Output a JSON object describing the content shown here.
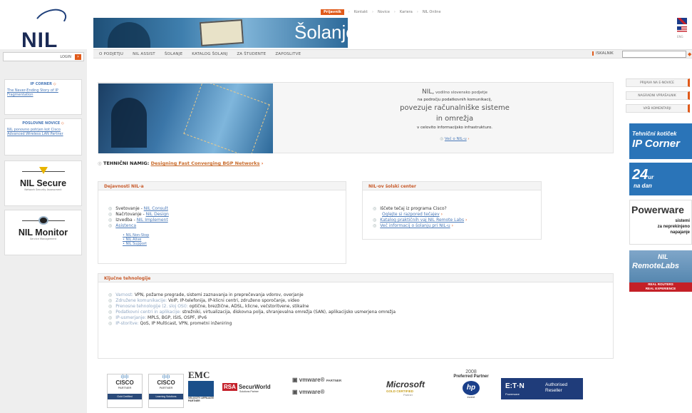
{
  "brand": {
    "logo_text": "NIL"
  },
  "topnav": {
    "active": "Prijavnik",
    "items": [
      "Kontakt",
      "Novice",
      "Kariera",
      "NIL Online"
    ]
  },
  "banner": {
    "title": "Šolanje"
  },
  "flags": {
    "label": "ENG"
  },
  "menu": {
    "items": [
      "O PODJETJU",
      "NIL ASSIST",
      "ŠOLANJE",
      "KATALOG ŠOLANJ",
      "ZA ŠTUDENTE",
      "ZAPOSLITVE"
    ],
    "search_label": "ISKALNIK",
    "search_placeholder": ""
  },
  "left": {
    "login": "LOGIN",
    "ip_corner": {
      "title": "IP CORNER",
      "text": "The Never-Ending Story of IP Fragmentation"
    },
    "news": {
      "title": "POSLOVNE NOVICE",
      "text": "NIL ponovno potrjen kot Cisco Advanced Wireless LAN Partner"
    },
    "secure": {
      "name": "NIL Secure",
      "sub": "Network Security Assessment"
    },
    "monitor": {
      "name": "NIL Monitor",
      "sub": "Service Management"
    }
  },
  "right": {
    "buttons": [
      "PRIJAVA NA E-NOVICE",
      "NAGRADNI VPRAŠALNIK",
      "VAŠI KOMENTARJI"
    ],
    "ipcorner": {
      "a": "Tehnični kotiček",
      "b": "IP Corner"
    },
    "h24": {
      "a": "24",
      "b": "ur",
      "c": "na dan"
    },
    "power": {
      "a": "Powerware",
      "b": "sistemi",
      "c": "za neprekinjeno",
      "d": "napajanje"
    },
    "remote": {
      "a": "NIL",
      "b": "RemoteLabs",
      "c": "REAL ROUTERS",
      "d": "REAL EXPERIENCE"
    }
  },
  "hero": {
    "l1": "NIL,",
    "l1b": " vodilno slovensko podjetje",
    "l2": "na področju podatkovnih komunikacij,",
    "l3": "povezuje računalniške sisteme",
    "l3b": "in omrežja",
    "l4": "v celovito informacijsko infrastrukturo.",
    "l5": "Več o NIL-u"
  },
  "tech": {
    "label": "TEHNIČNI NAMIG:",
    "link": "Designing Fast Converging BGP Networks"
  },
  "activities": {
    "title": "Dejavnosti NIL-a",
    "rows": [
      {
        "label": "Svetovanje - ",
        "link": "NIL Consult"
      },
      {
        "label": "Načrtovanje - ",
        "link": "NIL Design"
      },
      {
        "label": "Izvedba - ",
        "link": "NIL Implement"
      },
      {
        "label": "",
        "link": "Asistenca"
      }
    ],
    "sub": [
      "NIL Non-Stop",
      "NIL Alive",
      "NIL Support"
    ]
  },
  "school": {
    "title": "NIL-ov šolski center",
    "rows": [
      {
        "label": "Iščete tečaj iz programa Cisco?",
        "link": "Oglejte si razpored tečajev"
      },
      {
        "label": "",
        "link": "Katalog praktičnih vaj NIL Remote Labs"
      },
      {
        "label": "",
        "link": "Več informacij o šolanju pri NIL-u"
      }
    ]
  },
  "key": {
    "title": "Ključne tehnologije",
    "rows": [
      {
        "k": "Varnost:",
        "v": " VPN, požarne pregrade, sistemi zaznavanja in preprečevanja vdorov, overjanje"
      },
      {
        "k": "Združene komunikacije:",
        "v": " VoIP, IP-telefonija, IP-klicni centri, združeno sporočanje, video"
      },
      {
        "k": "Prenosne tehnologije (2. sloj OSI):",
        "v": " optične, brezžične, ADSL, klicne, večstoritvene, stikalne"
      },
      {
        "k": "Podatkovni centri in aplikacije:",
        "v": " strežniki, virtualizacija, diskovna polja, shranjevalna omrežja (SAN), aplikacijsko usmerjena omrežja"
      },
      {
        "k": "IP-usmerjanje:",
        "v": " MPLS, BGP, ISIS, OSPF, IPv6"
      },
      {
        "k": "IP-storitve:",
        "v": " QoS, IP Multicast, VPN, prometni inženiring"
      }
    ]
  },
  "partners": {
    "cisco1": "CISCO",
    "cisco1b": "PARTNER",
    "cisco1c": "Gold Certified",
    "cisco2": "CISCO",
    "cisco2b": "PARTNER",
    "cisco2c": "Learning Solutions",
    "emc": "EMC",
    "emcb": "VELOCITY AFFILIATE PARTNER",
    "rsa": "RSA",
    "rsab": "SecurWorld",
    "rsac": "Solutions Partner",
    "vm1": "vmware",
    "vm1b": "PARTNER",
    "vm2": "vmware",
    "ms": "Microsoft",
    "msb": "GOLD CERTIFIED",
    "msc": "Partner",
    "hp": "2008",
    "hpb": "Preferred Partner",
    "hpc": "hp",
    "hpd": "invent",
    "eaton": "E:T·N",
    "eatonb": "Authorised Reseller",
    "eatonc": "Powerware"
  }
}
